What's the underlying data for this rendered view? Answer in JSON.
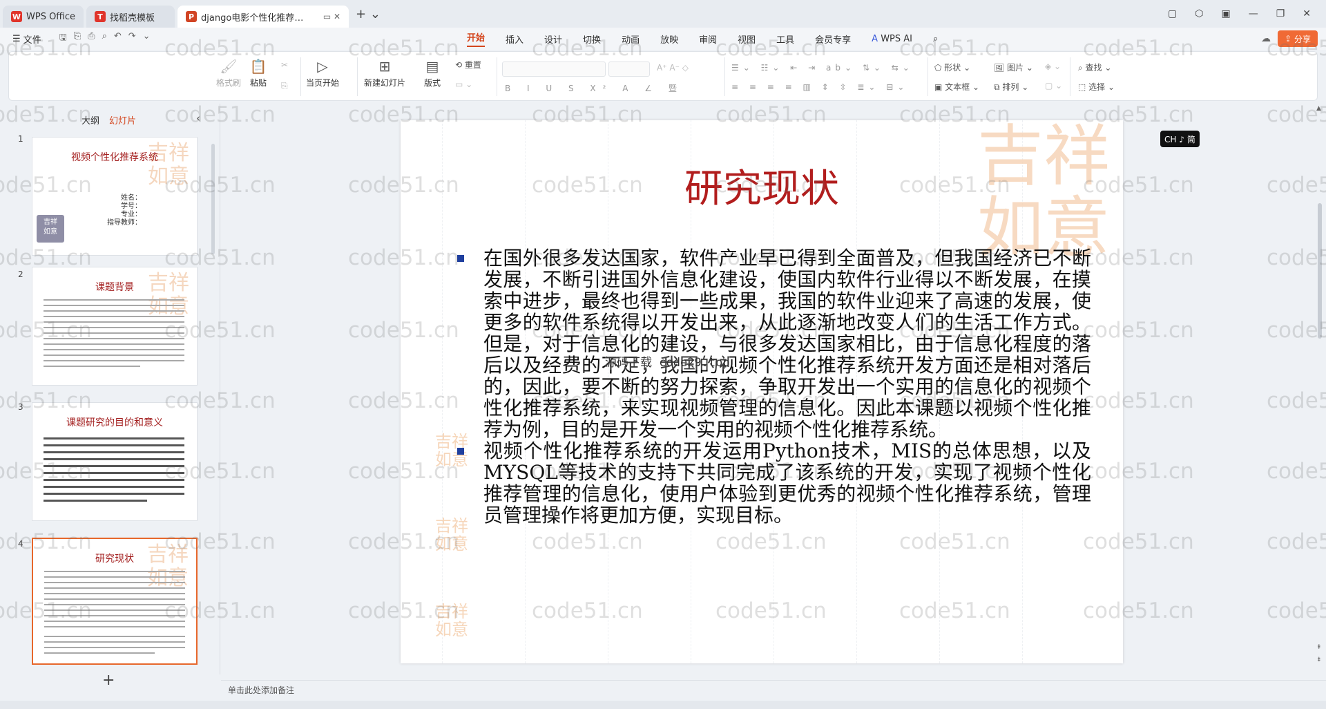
{
  "window": {
    "tabs": [
      {
        "label": "WPS Office",
        "logo": "W",
        "color": "#e0342b"
      },
      {
        "label": "找稻壳模板",
        "logo": "T",
        "color": "#e0342b"
      },
      {
        "label": "django电影个性化推荐系统",
        "logo": "P",
        "color": "#d14424"
      }
    ]
  },
  "menu": {
    "file": "文件",
    "ribbon_tabs": [
      "开始",
      "插入",
      "设计",
      "切换",
      "动画",
      "放映",
      "审阅",
      "视图",
      "工具",
      "会员专享"
    ],
    "wps_ai": "WPS AI",
    "share": "分享"
  },
  "ribbon": {
    "format_painter": "格式刷",
    "paste": "粘贴",
    "start_from_current": "当页开始",
    "new_slide": "新建幻灯片",
    "layout": "版式",
    "reset": "重置",
    "shape": "形状",
    "picture": "图片",
    "textbox": "文本框",
    "arrange": "排列",
    "find": "查找",
    "select": "选择"
  },
  "left_pane": {
    "tabs": [
      "大纲",
      "幻灯片"
    ],
    "slides": [
      {
        "num": "1",
        "title": "视频个性化推荐系统",
        "fields": [
          "姓名：",
          "学号：",
          "专业：",
          "指导教师："
        ]
      },
      {
        "num": "2",
        "title": "课题背景"
      },
      {
        "num": "3",
        "title": "课题研究的目的和意义"
      },
      {
        "num": "4",
        "title": "研究现状"
      }
    ]
  },
  "slide": {
    "title": "研究现状",
    "bullets": [
      "在国外很多发达国家，软件产业早已得到全面普及，但我国经济已不断发展，不断引进国外信息化建设，使国内软件行业得以不断发展，在摸索中进步，最终也得到一些成果，我国的软件业迎来了高速的发展，使更多的软件系统得以开发出来，从此逐渐地改变人们的生活工作方式。但是，对于信息化的建设，与很多发达国家相比，由于信息化程度的落后以及经费的不足，我国的视频个性化推荐系统开发方面还是相对落后的，因此，要不断的努力探索，争取开发出一个实用的信息化的视频个性化推荐系统，来实现视频管理的信息化。因此本课题以视频个性化推荐为例，目的是开发一个实用的视频个性化推荐系统。",
      "视频个性化推荐系统的开发运用Python技术，MIS的总体思想，以及MYSQL等技术的支持下共同完成了该系统的开发，实现了视频个性化推荐管理的信息化，使用户体验到更优秀的视频个性化推荐系统，管理员管理操作将更加方便，实现目标。"
    ],
    "overlay": "源码下载 code29.top"
  },
  "ime_badge": "CH ♪ 简",
  "notes_placeholder": "单击此处添加备注",
  "watermark": "code51.cn"
}
